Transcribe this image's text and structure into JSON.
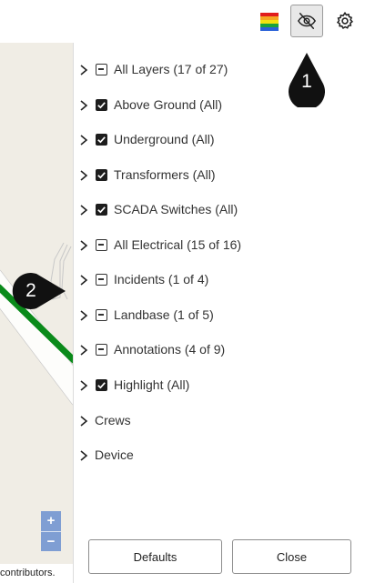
{
  "toolbar": {
    "rainbow_icon": "layer-color-legend-icon",
    "visibility_icon": "eye-off-icon",
    "settings_icon": "gear-icon",
    "rainbow_colors": [
      "#e11d1d",
      "#f5a623",
      "#f2e30f",
      "#1aa33b",
      "#2a62d8"
    ]
  },
  "map": {
    "zoom_in": "+",
    "zoom_out": "−",
    "attribution": "contributors."
  },
  "layers": [
    {
      "label": "All Layers (17 of 27)",
      "state": "partial"
    },
    {
      "label": "Above Ground (All)",
      "state": "checked"
    },
    {
      "label": "Underground (All)",
      "state": "checked"
    },
    {
      "label": "Transformers (All)",
      "state": "checked"
    },
    {
      "label": "SCADA Switches (All)",
      "state": "checked"
    },
    {
      "label": "All Electrical (15 of 16)",
      "state": "partial"
    },
    {
      "label": "Incidents (1 of 4)",
      "state": "partial"
    },
    {
      "label": "Landbase (1 of 5)",
      "state": "partial"
    },
    {
      "label": "Annotations (4 of 9)",
      "state": "partial"
    },
    {
      "label": "Highlight (All)",
      "state": "checked"
    },
    {
      "label": "Crews",
      "state": "none"
    },
    {
      "label": "Device",
      "state": "none"
    }
  ],
  "buttons": {
    "defaults": "Defaults",
    "close": "Close"
  },
  "callouts": {
    "one": "1",
    "two": "2"
  },
  "colors": {
    "map_bg": "#f0ede5",
    "power_line": "#0a8a1a",
    "zoom_bg": "#7f9ed3",
    "callout_bg": "#111111"
  }
}
